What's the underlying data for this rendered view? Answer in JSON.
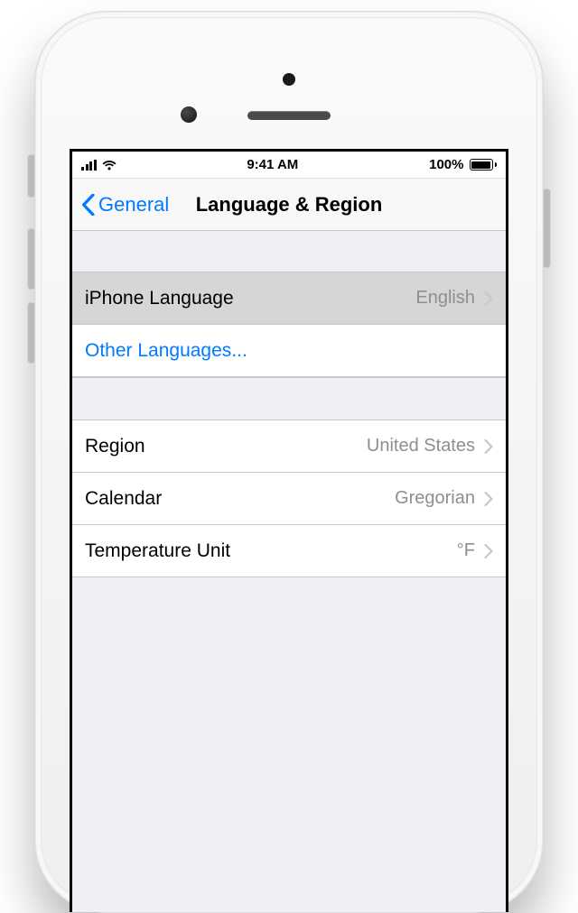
{
  "status": {
    "time": "9:41 AM",
    "battery_pct": "100%"
  },
  "nav": {
    "back_label": "General",
    "title": "Language & Region"
  },
  "rows": {
    "iphone_language": {
      "label": "iPhone Language",
      "value": "English"
    },
    "other_languages": {
      "label": "Other Languages..."
    },
    "region": {
      "label": "Region",
      "value": "United States"
    },
    "calendar": {
      "label": "Calendar",
      "value": "Gregorian"
    },
    "temperature": {
      "label": "Temperature Unit",
      "value": "°F"
    }
  }
}
